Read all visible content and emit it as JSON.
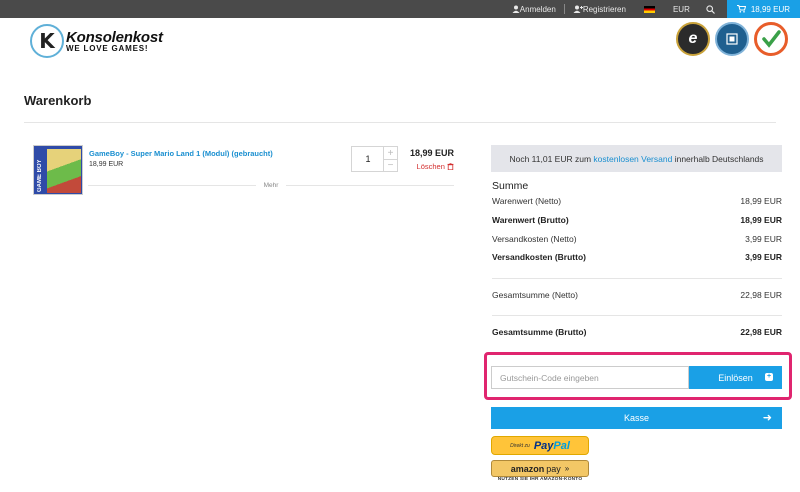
{
  "topbar": {
    "login": "Anmelden",
    "register": "Registrieren",
    "currency": "EUR",
    "cart_total": "18,99 EUR"
  },
  "header": {
    "logo_letter": "K",
    "logo_name": "Konsolenkost",
    "logo_tagline": "WE LOVE GAMES!",
    "seal_trusted_letter": "e"
  },
  "page": {
    "title": "Warenkorb"
  },
  "cart": {
    "items": [
      {
        "name": "GameBoy - Super Mario Land 1 (Modul) (gebraucht)",
        "unit_price": "18,99 EUR",
        "quantity": "1",
        "line_total": "18,99 EUR",
        "delete_label": "Löschen",
        "image_caption": "GAME BOY"
      }
    ],
    "more_label": "Mehr"
  },
  "summary": {
    "shipping_note_pre": "Noch 11,01 EUR zum ",
    "shipping_note_link": "kostenlosen Versand",
    "shipping_note_post": " innerhalb Deutschlands",
    "title": "Summe",
    "rows": [
      {
        "label": "Warenwert (Netto)",
        "value": "18,99 EUR"
      },
      {
        "label": "Warenwert (Brutto)",
        "value": "18,99 EUR"
      },
      {
        "label": "Versandkosten (Netto)",
        "value": "3,99 EUR"
      },
      {
        "label": "Versandkosten (Brutto)",
        "value": "3,99 EUR"
      },
      {
        "label": "Gesamtsumme (Netto)",
        "value": "22,98 EUR"
      },
      {
        "label": "Gesamtsumme (Brutto)",
        "value": "22,98 EUR"
      }
    ]
  },
  "coupon": {
    "placeholder": "Gutschein-Code eingeben",
    "button_label": "Einlösen"
  },
  "checkout": {
    "label": "Kasse"
  },
  "payment": {
    "paypal_prefix": "Direkt zu",
    "paypal_pay": "Pay",
    "paypal_pal": "Pal",
    "amazon_brand": "amazon",
    "amazon_pay": "pay",
    "amazon_note": "NUTZEN SIE IHR AMAZON-KONTO"
  },
  "colors": {
    "accent": "#1aa0e6",
    "highlight": "#e0256f",
    "delete": "#d32f2f",
    "topbar": "#4a4a4a"
  }
}
